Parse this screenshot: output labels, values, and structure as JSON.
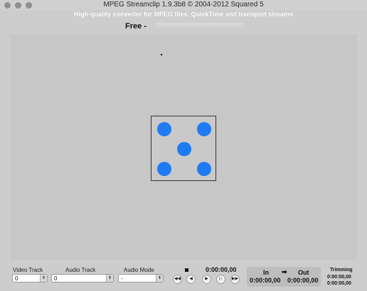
{
  "window": {
    "title": "MPEG Streamclip 1.9.3b8  ©  2004-2012 Squared 5",
    "subtitle": "High-quality converter for MPEG files, QuickTime and transport streams"
  },
  "free": {
    "label": "Free  -"
  },
  "controls": {
    "video_track": {
      "label": "Video Track",
      "value": "0"
    },
    "audio_track": {
      "label": "Audio Track",
      "value": "0"
    },
    "audio_mode": {
      "label": "Audio Mode",
      "value": "-"
    },
    "current_time": "0:00:00,00",
    "in_label": "In",
    "out_label": "Out",
    "arrow": "➡",
    "in_time": "0:00:00,00",
    "out_time": "0:00:00,00",
    "trimming_label": "Trimming",
    "trimming_start": "0:00:00,00",
    "trimming_end": "0:00:00,00"
  },
  "icons": {
    "rewind": "◀◀",
    "step_back": "◀",
    "play": "▶",
    "step_forward": "▷",
    "fast_forward": "▶▶",
    "dropdown": "⬍"
  },
  "colors": {
    "pip": "#1f7bf2"
  }
}
